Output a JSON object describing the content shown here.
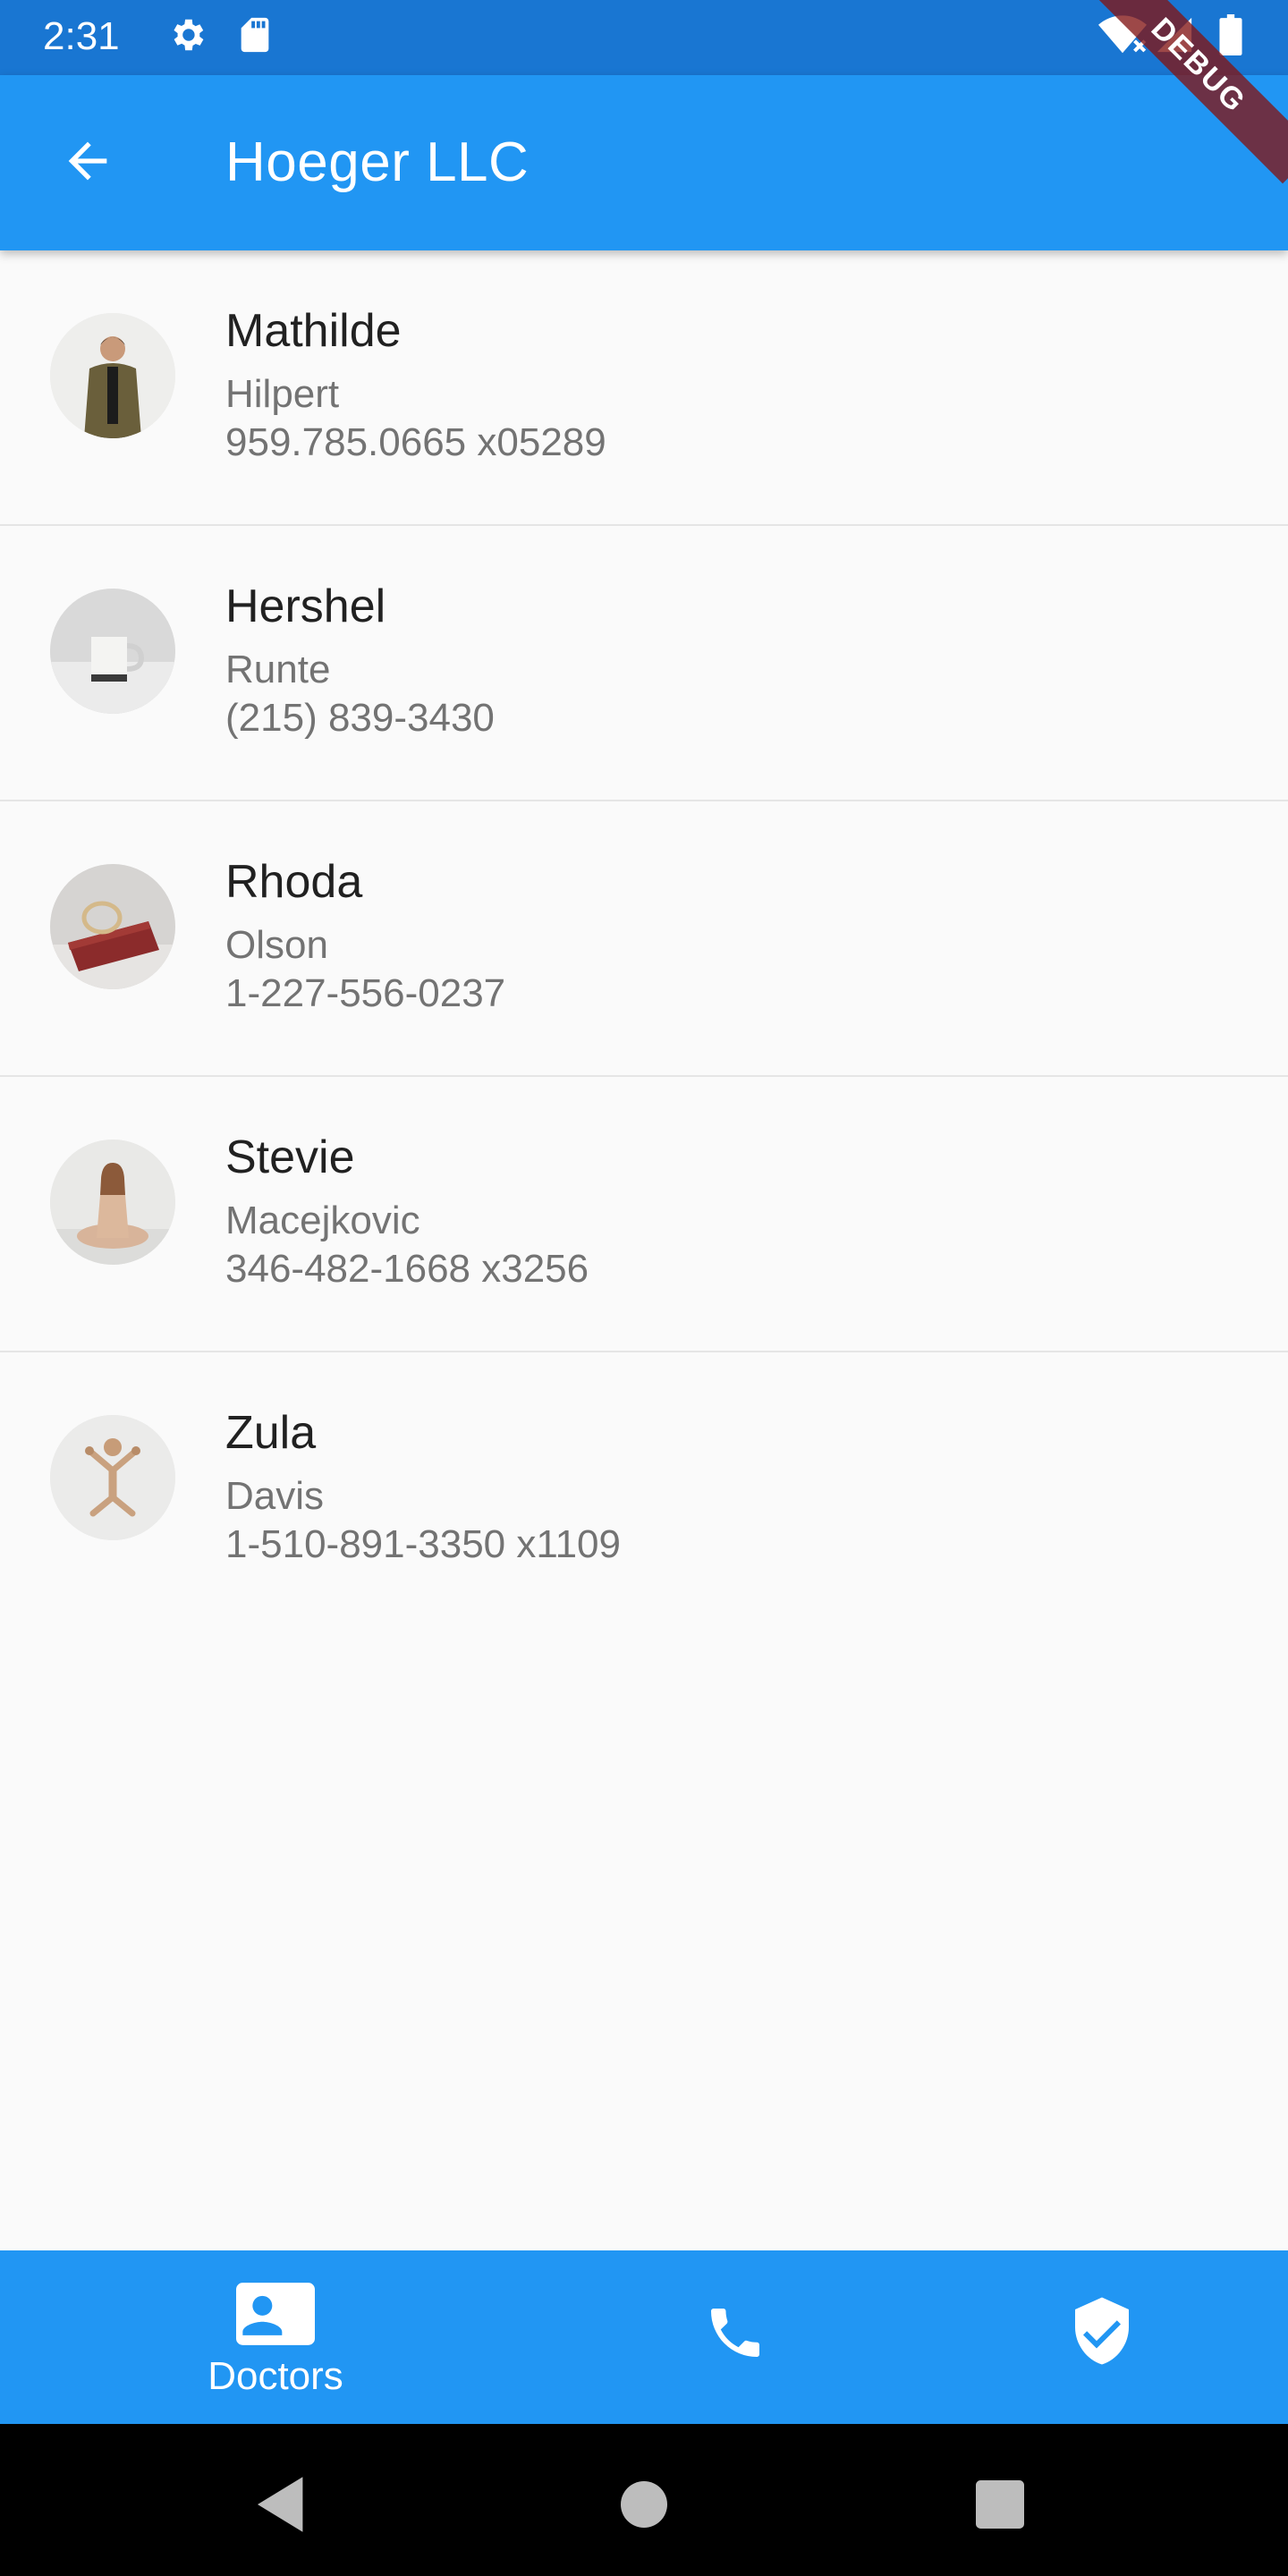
{
  "status_bar": {
    "time": "2:31",
    "icons": [
      "gear-icon",
      "sd-card-icon",
      "wifi-icon",
      "signal-icon",
      "battery-icon"
    ]
  },
  "debug_banner": "DEBUG",
  "app_bar": {
    "back_icon": "arrow-back-icon",
    "title": "Hoeger LLC"
  },
  "contacts": [
    {
      "first": "Mathilde",
      "last": "Hilpert",
      "phone": "959.785.0665 x05289",
      "avatar": "man-in-jacket-photo"
    },
    {
      "first": "Hershel",
      "last": "Runte",
      "phone": "(215) 839-3430",
      "avatar": "mug-photo"
    },
    {
      "first": "Rhoda",
      "last": "Olson",
      "phone": "1-227-556-0237",
      "avatar": "belt-photo"
    },
    {
      "first": "Stevie",
      "last": "Macejkovic",
      "phone": "346-482-1668 x3256",
      "avatar": "woman-sitting-photo"
    },
    {
      "first": "Zula",
      "last": "Davis",
      "phone": "1-510-891-3350 x1109",
      "avatar": "wooden-toy-photo"
    }
  ],
  "bottom_nav": [
    {
      "label": "Doctors",
      "icon": "contact-card-icon",
      "selected": true
    },
    {
      "label": "",
      "icon": "phone-icon",
      "selected": false
    },
    {
      "label": "",
      "icon": "verified-shield-icon",
      "selected": false
    }
  ],
  "system_nav": [
    "back-triangle-icon",
    "home-circle-icon",
    "recents-square-icon"
  ],
  "colors": {
    "primary": "#2196f3",
    "status_bar": "#1976d2",
    "text_primary": "#212121",
    "text_secondary": "#737373"
  }
}
